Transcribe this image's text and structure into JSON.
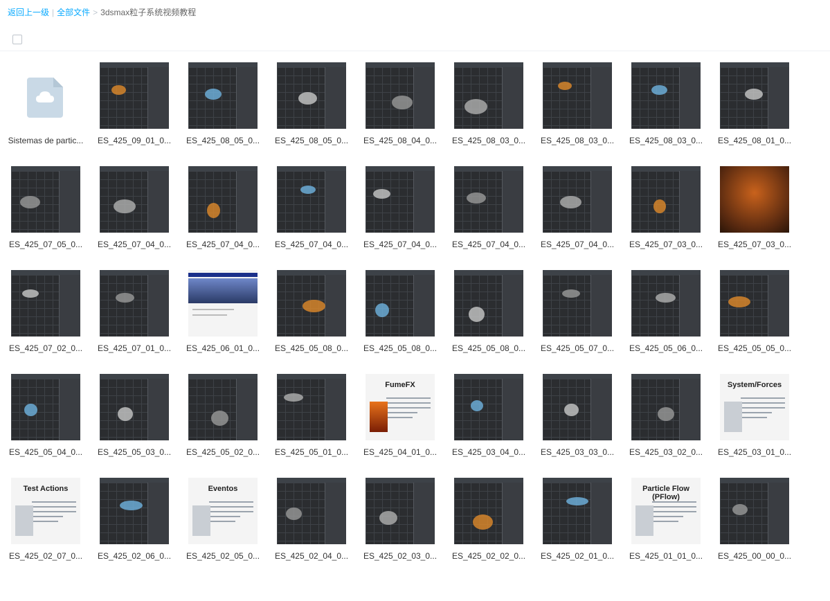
{
  "breadcrumb": {
    "back": "返回上一级",
    "all_files": "全部文件",
    "current": "3dsmax粒子系统视频教程",
    "separator_1": "|",
    "separator_2": ">"
  },
  "files": [
    {
      "name": "Sistemas de partic...",
      "type": "folder"
    },
    {
      "name": "ES_425_09_01_0...",
      "type": "video",
      "style": "dark"
    },
    {
      "name": "ES_425_08_05_0...",
      "type": "video",
      "style": "dark"
    },
    {
      "name": "ES_425_08_05_0...",
      "type": "video",
      "style": "dark"
    },
    {
      "name": "ES_425_08_04_0...",
      "type": "video",
      "style": "dark"
    },
    {
      "name": "ES_425_08_03_0...",
      "type": "video",
      "style": "dark"
    },
    {
      "name": "ES_425_08_03_0...",
      "type": "video",
      "style": "dark"
    },
    {
      "name": "ES_425_08_03_0...",
      "type": "video",
      "style": "dark"
    },
    {
      "name": "ES_425_08_01_0...",
      "type": "video",
      "style": "dark"
    },
    {
      "name": "ES_425_07_05_0...",
      "type": "video",
      "style": "dark"
    },
    {
      "name": "ES_425_07_04_0...",
      "type": "video",
      "style": "dark"
    },
    {
      "name": "ES_425_07_04_0...",
      "type": "video",
      "style": "dark"
    },
    {
      "name": "ES_425_07_04_0...",
      "type": "video",
      "style": "dark"
    },
    {
      "name": "ES_425_07_04_0...",
      "type": "video",
      "style": "dark"
    },
    {
      "name": "ES_425_07_04_0...",
      "type": "video",
      "style": "dark"
    },
    {
      "name": "ES_425_07_04_0...",
      "type": "video",
      "style": "dark"
    },
    {
      "name": "ES_425_07_03_0...",
      "type": "video",
      "style": "dark"
    },
    {
      "name": "ES_425_07_03_0...",
      "type": "video",
      "style": "orange"
    },
    {
      "name": "ES_425_07_02_0...",
      "type": "video",
      "style": "dark"
    },
    {
      "name": "ES_425_07_01_0...",
      "type": "video",
      "style": "dark"
    },
    {
      "name": "ES_425_06_01_0...",
      "type": "video",
      "style": "web"
    },
    {
      "name": "ES_425_05_08_0...",
      "type": "video",
      "style": "dark"
    },
    {
      "name": "ES_425_05_08_0...",
      "type": "video",
      "style": "dark"
    },
    {
      "name": "ES_425_05_08_0...",
      "type": "video",
      "style": "dark"
    },
    {
      "name": "ES_425_05_07_0...",
      "type": "video",
      "style": "dark"
    },
    {
      "name": "ES_425_05_06_0...",
      "type": "video",
      "style": "dark"
    },
    {
      "name": "ES_425_05_05_0...",
      "type": "video",
      "style": "dark"
    },
    {
      "name": "ES_425_05_04_0...",
      "type": "video",
      "style": "dark"
    },
    {
      "name": "ES_425_05_03_0...",
      "type": "video",
      "style": "dark"
    },
    {
      "name": "ES_425_05_02_0...",
      "type": "video",
      "style": "dark"
    },
    {
      "name": "ES_425_05_01_0...",
      "type": "video",
      "style": "dark"
    },
    {
      "name": "ES_425_04_01_0...",
      "type": "video",
      "style": "slide",
      "slide_title": "FumeFX"
    },
    {
      "name": "ES_425_03_04_0...",
      "type": "video",
      "style": "dark"
    },
    {
      "name": "ES_425_03_03_0...",
      "type": "video",
      "style": "dark"
    },
    {
      "name": "ES_425_03_02_0...",
      "type": "video",
      "style": "dark"
    },
    {
      "name": "ES_425_03_01_0...",
      "type": "video",
      "style": "slide",
      "slide_title": "System/Forces"
    },
    {
      "name": "ES_425_02_07_0...",
      "type": "video",
      "style": "slide",
      "slide_title": "Test Actions"
    },
    {
      "name": "ES_425_02_06_0...",
      "type": "video",
      "style": "dark"
    },
    {
      "name": "ES_425_02_05_0...",
      "type": "video",
      "style": "slide",
      "slide_title": "Eventos"
    },
    {
      "name": "ES_425_02_04_0...",
      "type": "video",
      "style": "dark"
    },
    {
      "name": "ES_425_02_03_0...",
      "type": "video",
      "style": "dark"
    },
    {
      "name": "ES_425_02_02_0...",
      "type": "video",
      "style": "dark"
    },
    {
      "name": "ES_425_02_01_0...",
      "type": "video",
      "style": "dark"
    },
    {
      "name": "ES_425_01_01_0...",
      "type": "video",
      "style": "slide",
      "slide_title": "Particle Flow (PFlow)"
    },
    {
      "name": "ES_425_00_00_0...",
      "type": "video",
      "style": "dark"
    }
  ],
  "colors": {
    "link": "#09aaff",
    "thumb_dark": "#2b2d30",
    "folder_icon": "#c9d9e6"
  }
}
